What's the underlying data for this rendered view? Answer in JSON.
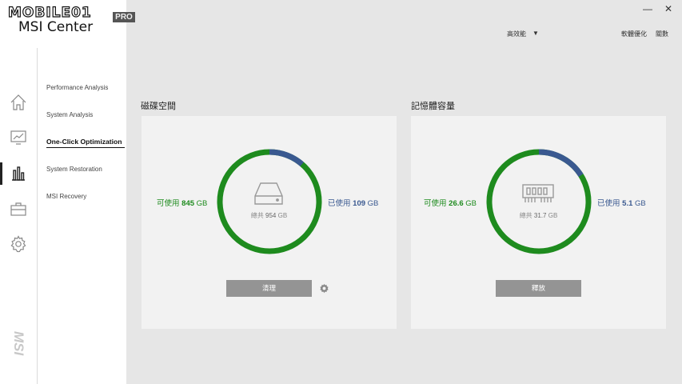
{
  "logo": {
    "brand": "MOBILE01",
    "badge": "PRO",
    "title": "MSI Center"
  },
  "window_controls": {
    "minimize": "—",
    "close": "✕"
  },
  "header": {
    "mode": "高效能",
    "mode_arrow": "▼",
    "optimize_label": "軟體優化",
    "about_label": "關數"
  },
  "iconbar": {
    "icons": [
      "home-icon",
      "monitor-chart-icon",
      "bar-chart-icon",
      "toolbox-icon",
      "settings-gear-icon"
    ],
    "brand_vertical": "MSI"
  },
  "submenu": {
    "items": [
      {
        "label": "Performance Analysis"
      },
      {
        "label": "System Analysis"
      },
      {
        "label": "One-Click Optimization"
      },
      {
        "label": "System Restoration"
      },
      {
        "label": "MSI Recovery"
      }
    ],
    "active_index": 2
  },
  "disk": {
    "title": "磁碟空間",
    "available_prefix": "可使用",
    "available_value": "845",
    "available_unit": "GB",
    "used_prefix": "已使用",
    "used_value": "109",
    "used_unit": "GB",
    "total_prefix": "總共",
    "total_value": "954",
    "total_unit": "GB",
    "used_fraction": 0.114,
    "button_label": "清理"
  },
  "memory": {
    "title": "記憶體容量",
    "available_prefix": "可使用",
    "available_value": "26.6",
    "available_unit": "GB",
    "used_prefix": "已使用",
    "used_value": "5.1",
    "used_unit": "GB",
    "total_prefix": "總共",
    "total_value": "31.7",
    "total_unit": "GB",
    "used_fraction": 0.161,
    "button_label": "釋放"
  },
  "colors": {
    "available": "#1e8b1e",
    "used": "#3a5990",
    "button": "#949494"
  }
}
